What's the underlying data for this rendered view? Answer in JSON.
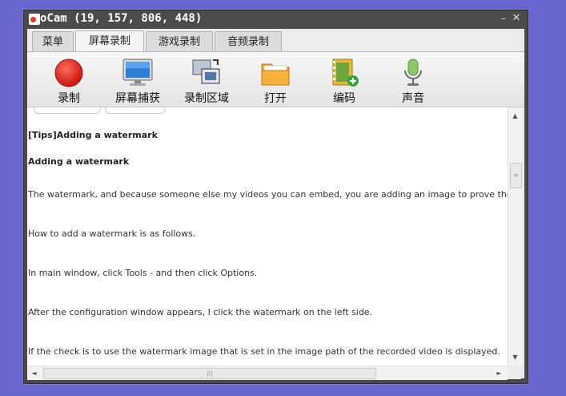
{
  "window": {
    "title": "oCam (19, 157, 806, 448)",
    "minimize_glyph": "–",
    "close_glyph": "✕"
  },
  "tabs": [
    {
      "label": "菜单"
    },
    {
      "label": "屏幕录制",
      "active": true
    },
    {
      "label": "游戏录制"
    },
    {
      "label": "音频录制"
    }
  ],
  "toolbar": [
    {
      "label": "录制",
      "icon": "record-icon"
    },
    {
      "label": "屏幕捕获",
      "icon": "monitor-icon"
    },
    {
      "label": "录制区域",
      "icon": "region-icon"
    },
    {
      "label": "打开",
      "icon": "folder-icon"
    },
    {
      "label": "编码",
      "icon": "film-add-icon"
    },
    {
      "label": "声音",
      "icon": "microphone-icon"
    }
  ],
  "content": {
    "lines": [
      "[Tips]Adding a watermark",
      "Adding a watermark",
      "The watermark, and because someone else my videos you can embed, you are adding an image to prove the source to",
      "How to add a watermark is as follows.",
      "In main window, click Tools - and then click Options.",
      "After the configuration window appears, I click the watermark on the left side.",
      "If the check is to use the watermark image that is set in the image path of the recorded video is displayed."
    ]
  },
  "scrollbars": {
    "up": "▲",
    "down": "▼",
    "left": "◄",
    "right": "►",
    "thumb_grip_v": "=",
    "thumb_grip_h": "|||"
  },
  "colors": {
    "desktop": "#6a66cf",
    "titlebar": "#4b4b4b",
    "record_red": "#e0201a"
  }
}
